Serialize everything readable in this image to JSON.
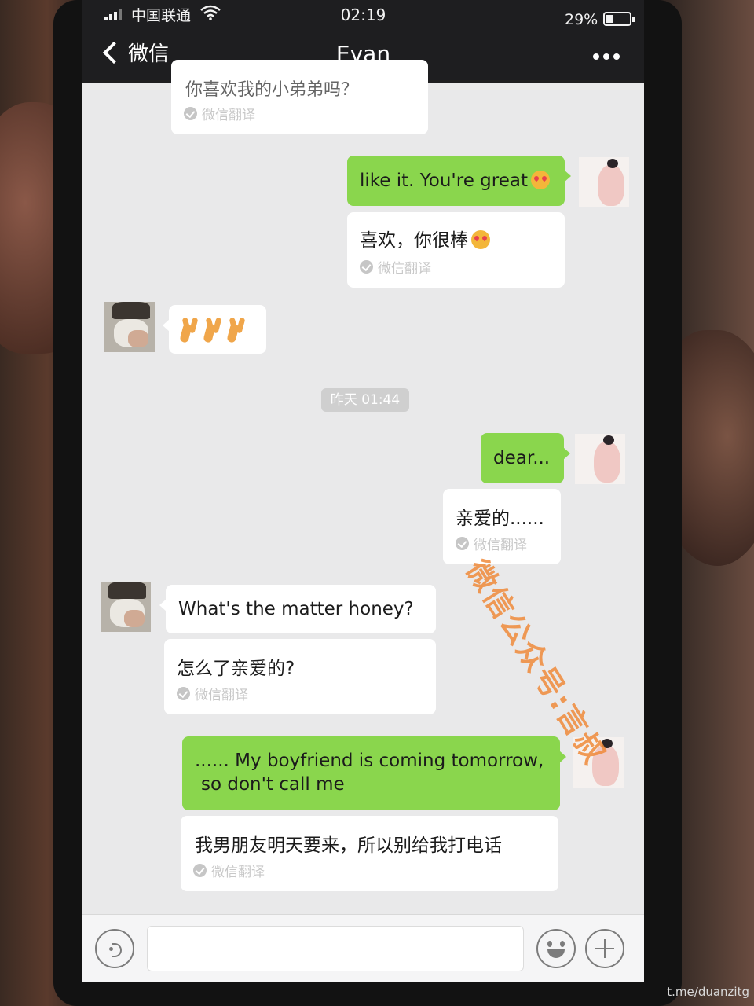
{
  "status_bar": {
    "carrier": "中国联通",
    "time": "02:19",
    "battery_percent": "29%",
    "battery_level": 0.29
  },
  "nav": {
    "back_label": "微信",
    "title": "Evan"
  },
  "messages": {
    "m0_partial": "你喜欢我的小弟弟吗？",
    "m0_translate": "微信翻译",
    "m1_text": "like it. You're great",
    "m1_trans": "喜欢，你很棒",
    "m1_translate": "微信翻译",
    "m2_time": "昨天 01:44",
    "m3_text": "dear...",
    "m3_trans": "亲爱的......",
    "m3_translate": "微信翻译",
    "m4_text": "What's the matter honey?",
    "m4_trans": "怎么了亲爱的?",
    "m4_translate": "微信翻译",
    "m5_line1": "...... My boyfriend is coming tomorrow,",
    "m5_line2": "so don't call me",
    "m5_trans": "我男朋友明天要来，所以别给我打电话",
    "m5_translate": "微信翻译"
  },
  "overlays": {
    "watermark": "微信公众号:言叔",
    "credit": "t.me/duanzitg"
  },
  "colors": {
    "sent_bubble": "#8ad64d",
    "received_bubble": "#ffffff",
    "chat_background": "#e9e9ea",
    "top_bar": "#1e1e20",
    "watermark": "#f08a3a"
  },
  "icons": [
    "signal-icon",
    "wifi-icon",
    "battery-icon",
    "back-chevron-icon",
    "more-icon",
    "voice-icon",
    "emoji-icon",
    "plus-icon",
    "translate-check-icon",
    "heart-eyes-emoji",
    "peace-hand-emoji"
  ]
}
